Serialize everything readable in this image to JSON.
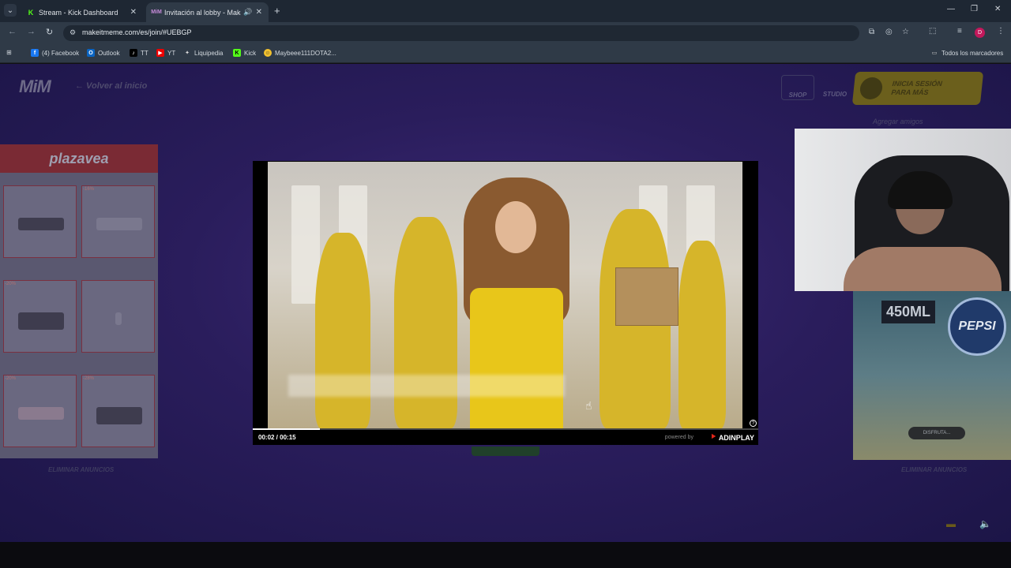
{
  "tabs": [
    {
      "title": "Stream - Kick Dashboard",
      "favicon": "kick-icon"
    },
    {
      "title": "Invitación al lobby - Make",
      "favicon": "mim-icon"
    }
  ],
  "address": {
    "url": "makeitmeme.com/es/join/#UEBGP"
  },
  "profile_initial": "D",
  "bookmarks": [
    {
      "label": "(4) Facebook",
      "icon": "facebook-icon"
    },
    {
      "label": "Outlook",
      "icon": "outlook-icon"
    },
    {
      "label": "TT",
      "icon": "tiktok-icon"
    },
    {
      "label": "YT",
      "icon": "youtube-icon"
    },
    {
      "label": "Liquipedia",
      "icon": "liquipedia-icon"
    },
    {
      "label": "Kick",
      "icon": "kick-icon"
    },
    {
      "label": "Maybeee111DOTA2...",
      "icon": "smiley-icon"
    }
  ],
  "bookmarks_all": "Todos los marcadores",
  "site": {
    "logo": "MiM",
    "back_label": "← Volver al inicio",
    "shop_label": "SHOP",
    "studio_label": "STUDIO",
    "login_label_line1": "INICIA SESIÓN",
    "login_label_line2": "PARA MÁS",
    "add_friends": "Agregar amigos",
    "remove_ads_left": "ELIMINAR ANUNCIOS",
    "remove_ads_right": "ELIMINAR ANUNCIOS"
  },
  "left_ad": {
    "brand": "plazavea",
    "products": [
      {
        "discount": "",
        "price": ""
      },
      {
        "discount": "-16%",
        "price": ""
      },
      {
        "discount": "-20%",
        "price": ""
      },
      {
        "discount": "",
        "price": ""
      },
      {
        "discount": "-20%",
        "price": ""
      },
      {
        "discount": "-28%",
        "price": ""
      }
    ]
  },
  "right_ad": {
    "volume": "450ML",
    "brand": "PEPSI",
    "cta": "DISFRUTA..."
  },
  "video_ad": {
    "time": "00:02 / 00:15",
    "progress": 0.133,
    "powered_by": "powered by",
    "provider": "ADINPLAY"
  },
  "colors": {
    "accent": "#e0261a",
    "page_bg": "#2a1d5c",
    "login": "#6b5f1c"
  }
}
